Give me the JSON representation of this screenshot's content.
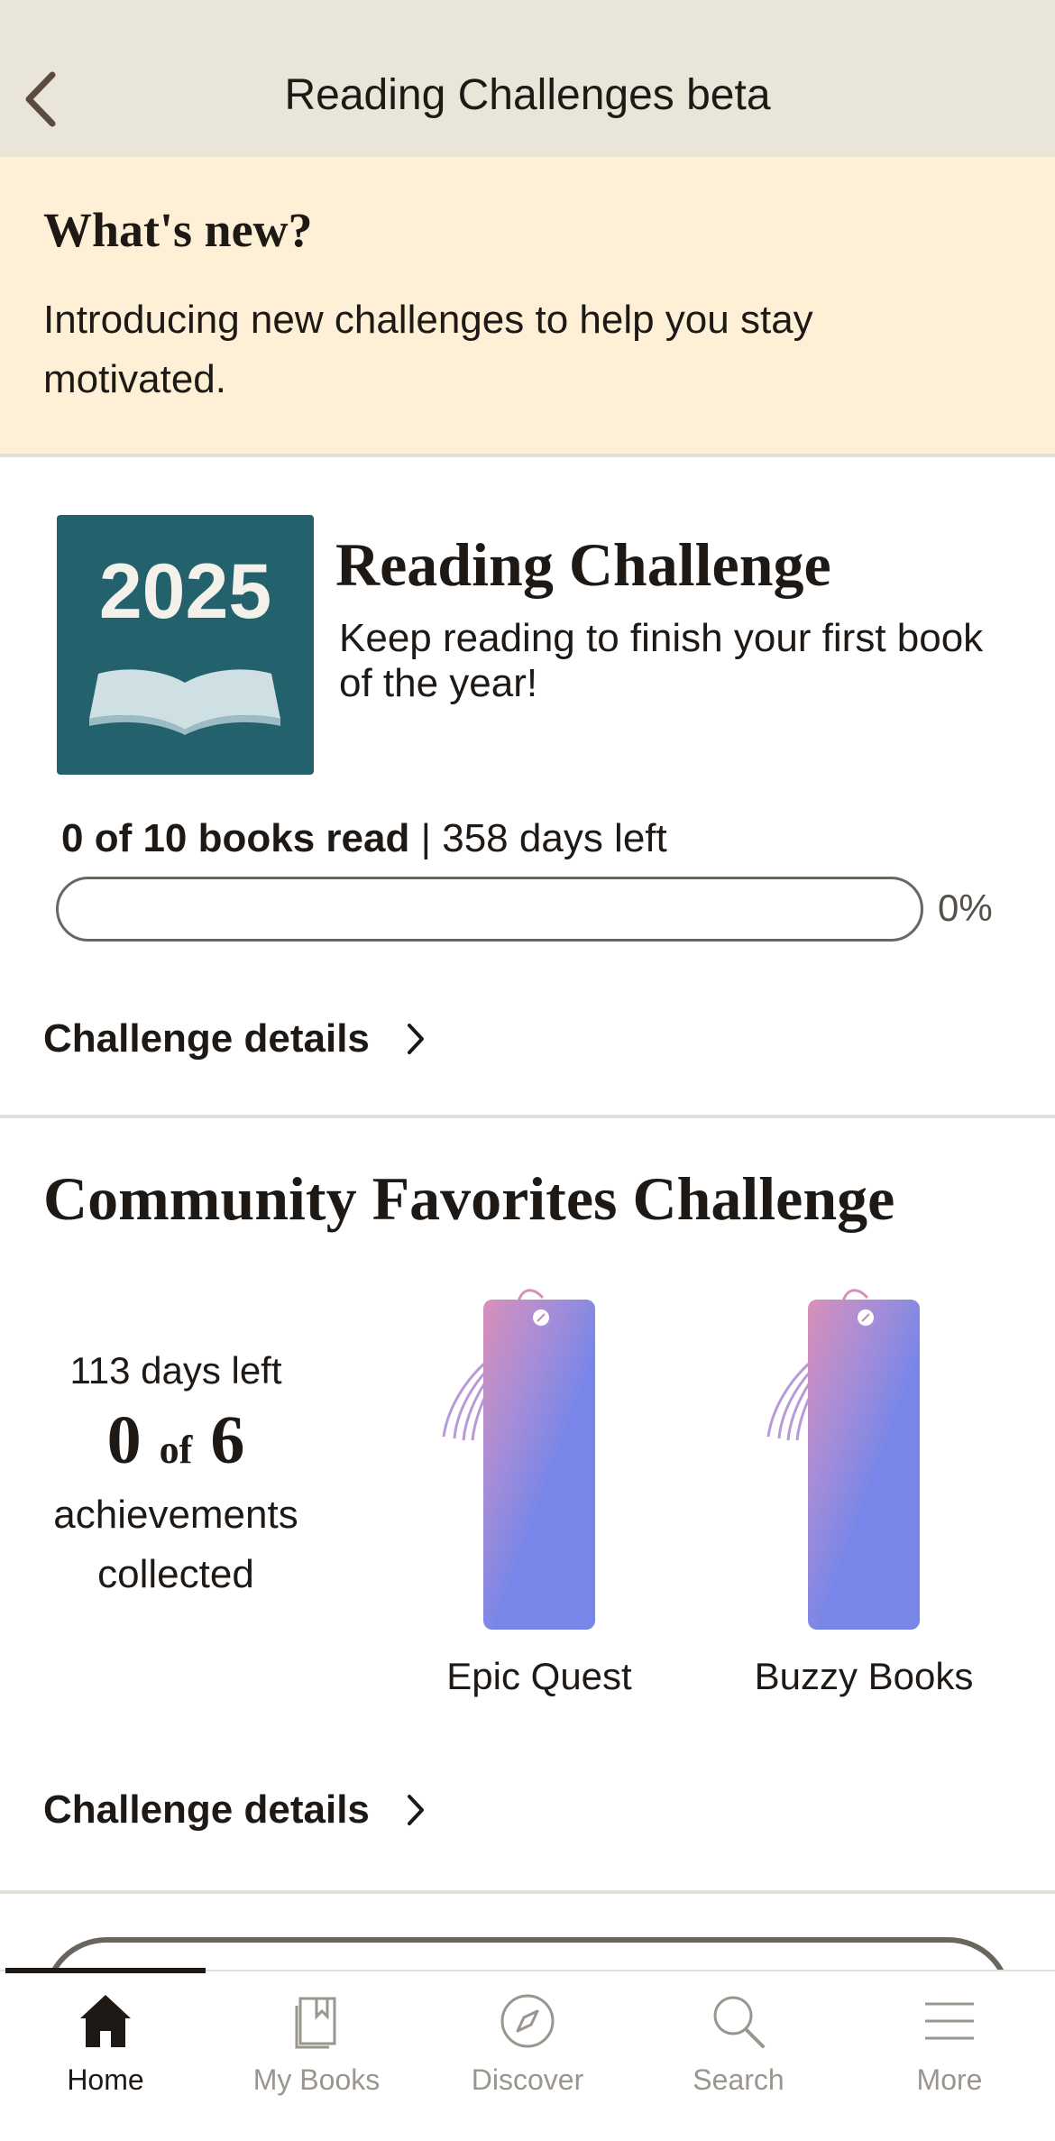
{
  "header": {
    "title": "Reading Challenges beta"
  },
  "whats_new": {
    "title": "What's new?",
    "body": "Introducing new challenges to help you stay motivated."
  },
  "reading_challenge": {
    "badge_year": "2025",
    "title": "Reading Challenge",
    "description": "Keep reading to finish your first book of the year!",
    "progress_bold": "0 of 10 books read",
    "progress_rest": " | 358 days left",
    "percent_label": "0%",
    "progress_fraction": 0,
    "details_label": "Challenge details"
  },
  "community_challenge": {
    "title": "Community Favorites Challenge",
    "days_left": "113 days left",
    "collected": "0",
    "of": "of",
    "total": "6",
    "achievements_label": "achievements collected",
    "bookmarks": [
      {
        "label": "Epic Quest"
      },
      {
        "label": "Buzzy Books"
      }
    ],
    "details_label": "Challenge details"
  },
  "tabs": [
    {
      "label": "Home",
      "icon": "home-icon",
      "active": true
    },
    {
      "label": "My Books",
      "icon": "my-books-icon",
      "active": false
    },
    {
      "label": "Discover",
      "icon": "compass-icon",
      "active": false
    },
    {
      "label": "Search",
      "icon": "search-icon",
      "active": false
    },
    {
      "label": "More",
      "icon": "menu-icon",
      "active": false
    }
  ],
  "colors": {
    "header_bg": "#e9e5d8",
    "banner_bg": "#fdf0d7",
    "badge_bg": "#23616c",
    "bookmark_top": "#d98fb9",
    "bookmark_bottom": "#7786e8"
  }
}
